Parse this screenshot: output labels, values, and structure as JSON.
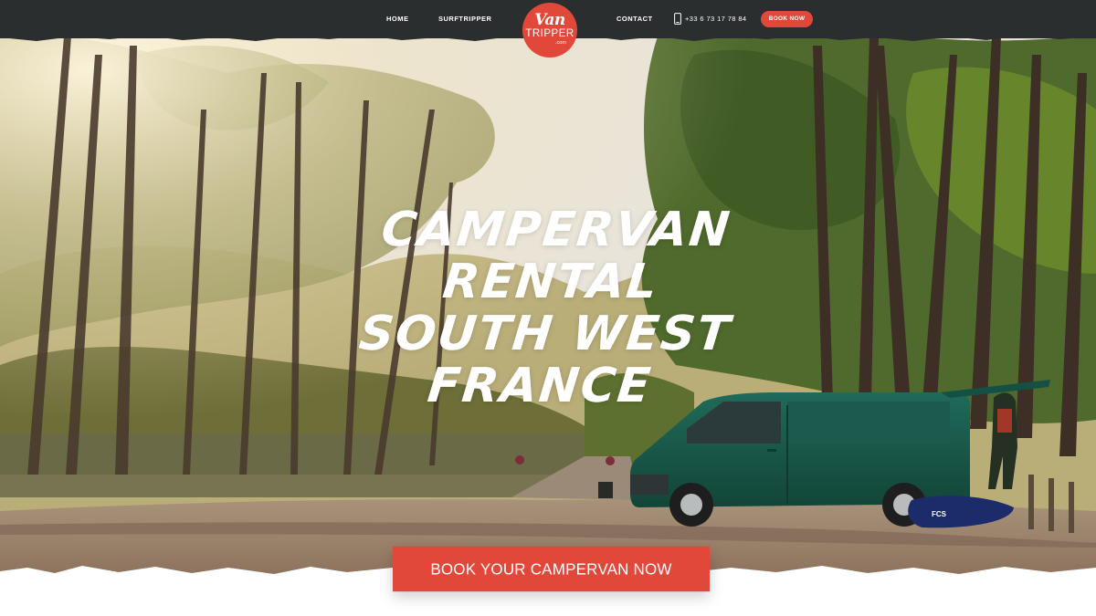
{
  "brand": {
    "logo_script": "Van",
    "logo_name": "TRIPPER",
    "logo_domain": ".com",
    "accent_color": "#e2483a",
    "nav_bg_color": "#2b2e2f"
  },
  "nav": {
    "home": "HOME",
    "surftripper": "SURFTRIPPER",
    "contact": "CONTACT",
    "phone_icon": "phone-icon",
    "phone": "+33 6 73 17 78 84",
    "book_now": "BOOK NOW"
  },
  "hero": {
    "headline_line1": "CAMPERVAN RENTAL",
    "headline_line2": "SOUTH WEST",
    "headline_line3": "FRANCE",
    "cta": "BOOK YOUR CAMPERVAN NOW"
  }
}
